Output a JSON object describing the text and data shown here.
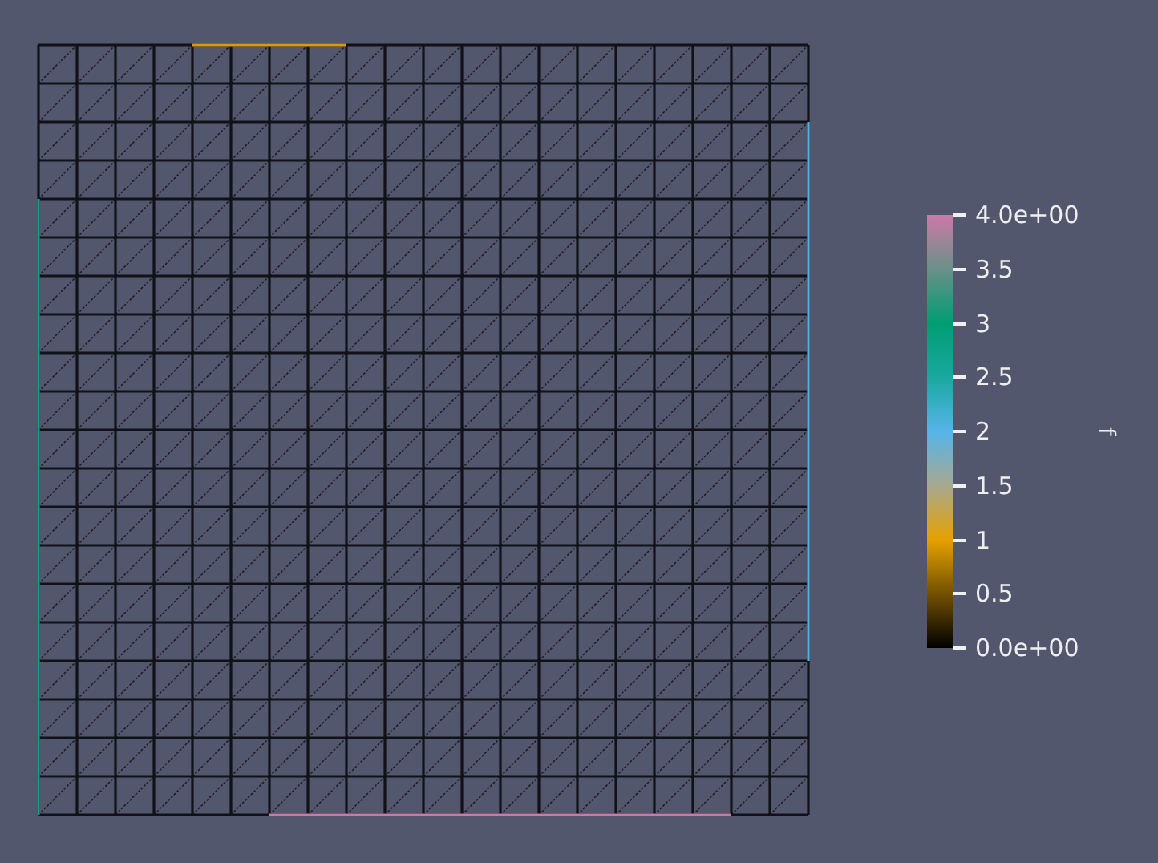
{
  "colorbar": {
    "title": "f",
    "ticks": [
      "4.0e+00",
      "3.5",
      "3",
      "2.5",
      "2",
      "1.5",
      "1",
      "0.5",
      "0.0e+00"
    ]
  }
}
